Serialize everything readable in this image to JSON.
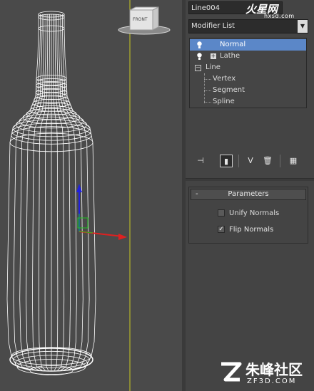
{
  "object_name": "Line004",
  "top_logo": {
    "text": "火星网",
    "url": "hxsd.com"
  },
  "modifier_list": {
    "label": "Modifier List"
  },
  "viewcube_label": "FRONT",
  "stack": {
    "items": [
      {
        "label": "Normal",
        "selected": true
      },
      {
        "label": "Lathe",
        "selected": false
      },
      {
        "label": "Line",
        "selected": false
      }
    ],
    "subobjects": [
      "Vertex",
      "Segment",
      "Spline"
    ]
  },
  "parameters": {
    "title": "Parameters",
    "collapse_symbol": "-",
    "unify_normals": {
      "label": "Unify Normals",
      "checked": false
    },
    "flip_normals": {
      "label": "Flip Normals",
      "checked": true
    }
  },
  "toolbar_icons": [
    "pin-stack-icon",
    "show-end-result-icon",
    "make-unique-icon",
    "remove-modifier-icon",
    "configure-modifier-sets-icon"
  ],
  "watermark": {
    "text": "朱峰社区",
    "url": "ZF3D.COM"
  },
  "colors": {
    "selection": "#5b87c8",
    "viewport_bg": "#4a4a4a",
    "panel_bg": "#444444",
    "gizmo_y": "#2020e0",
    "gizmo_x": "#e02020",
    "gizmo_z": "#20c020"
  }
}
